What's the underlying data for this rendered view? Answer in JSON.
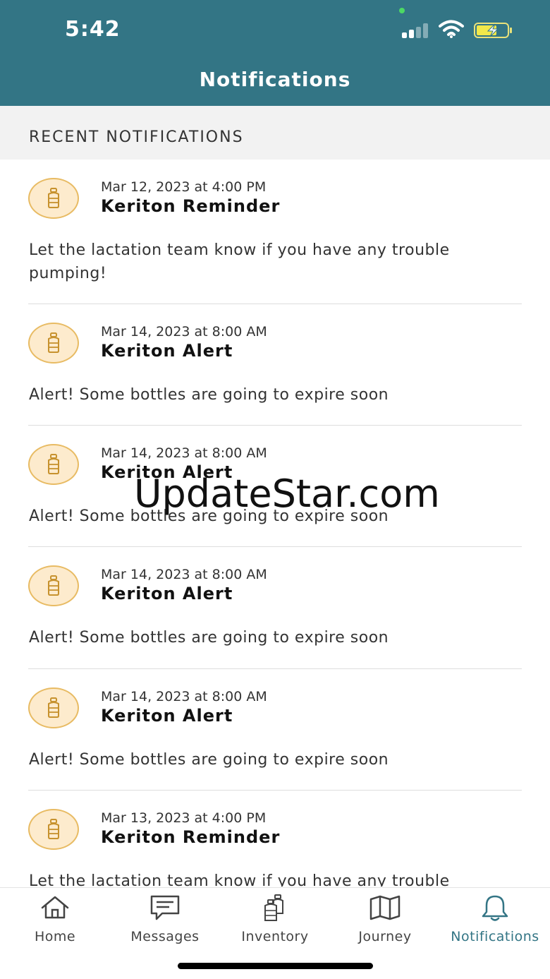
{
  "colors": {
    "header_bg": "#337585",
    "accent": "#337585",
    "icon_bg": "#fdebcd",
    "icon_border": "#e8bb63",
    "section_bg": "#f2f2f2"
  },
  "status_bar": {
    "time": "5:42",
    "icons": [
      "signal-icon",
      "wifi-icon",
      "battery-charging-icon"
    ]
  },
  "header": {
    "title": "Notifications"
  },
  "section": {
    "title": "RECENT NOTIFICATIONS"
  },
  "notifications": [
    {
      "icon": "bottle-icon",
      "date": "Mar 12, 2023 at 4:00 PM",
      "title": "Keriton Reminder",
      "body": "Let the lactation team know if you have any trouble pumping!"
    },
    {
      "icon": "bottle-icon",
      "date": "Mar 14, 2023 at 8:00 AM",
      "title": "Keriton Alert",
      "body": "Alert! Some bottles are going to expire soon"
    },
    {
      "icon": "bottle-icon",
      "date": "Mar 14, 2023 at 8:00 AM",
      "title": "Keriton Alert",
      "body": "Alert! Some bottles are going to expire soon"
    },
    {
      "icon": "bottle-icon",
      "date": "Mar 14, 2023 at 8:00 AM",
      "title": "Keriton Alert",
      "body": "Alert! Some bottles are going to expire soon"
    },
    {
      "icon": "bottle-icon",
      "date": "Mar 14, 2023 at 8:00 AM",
      "title": "Keriton Alert",
      "body": "Alert! Some bottles are going to expire soon"
    },
    {
      "icon": "bottle-icon",
      "date": "Mar 13, 2023 at 4:00 PM",
      "title": "Keriton Reminder",
      "body": "Let the lactation team know if you have any trouble pumping!"
    }
  ],
  "watermark": {
    "text": "UpdateStar.com"
  },
  "tabbar": {
    "tabs": [
      {
        "label": "Home",
        "icon": "home-icon"
      },
      {
        "label": "Messages",
        "icon": "message-icon"
      },
      {
        "label": "Inventory",
        "icon": "bottles-icon"
      },
      {
        "label": "Journey",
        "icon": "map-icon"
      },
      {
        "label": "Notifications",
        "icon": "bell-icon",
        "active": true
      }
    ]
  }
}
